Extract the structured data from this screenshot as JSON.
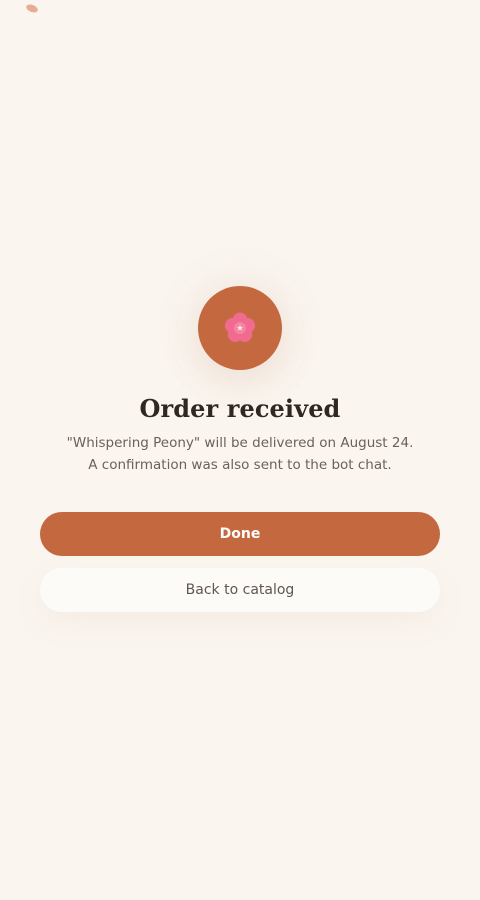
{
  "decoration": {
    "icon": "petal-decoration"
  },
  "confirmation": {
    "icon": "flower-icon",
    "title": "Order received",
    "message": "\"Whispering Peony\" will be delivered on August 24. A confirmation was also sent to the bot chat."
  },
  "actions": {
    "done_label": "Done",
    "back_label": "Back to catalog"
  },
  "colors": {
    "accent": "#c46840",
    "background": "#faf5ef",
    "flower": "#f06b8f"
  }
}
